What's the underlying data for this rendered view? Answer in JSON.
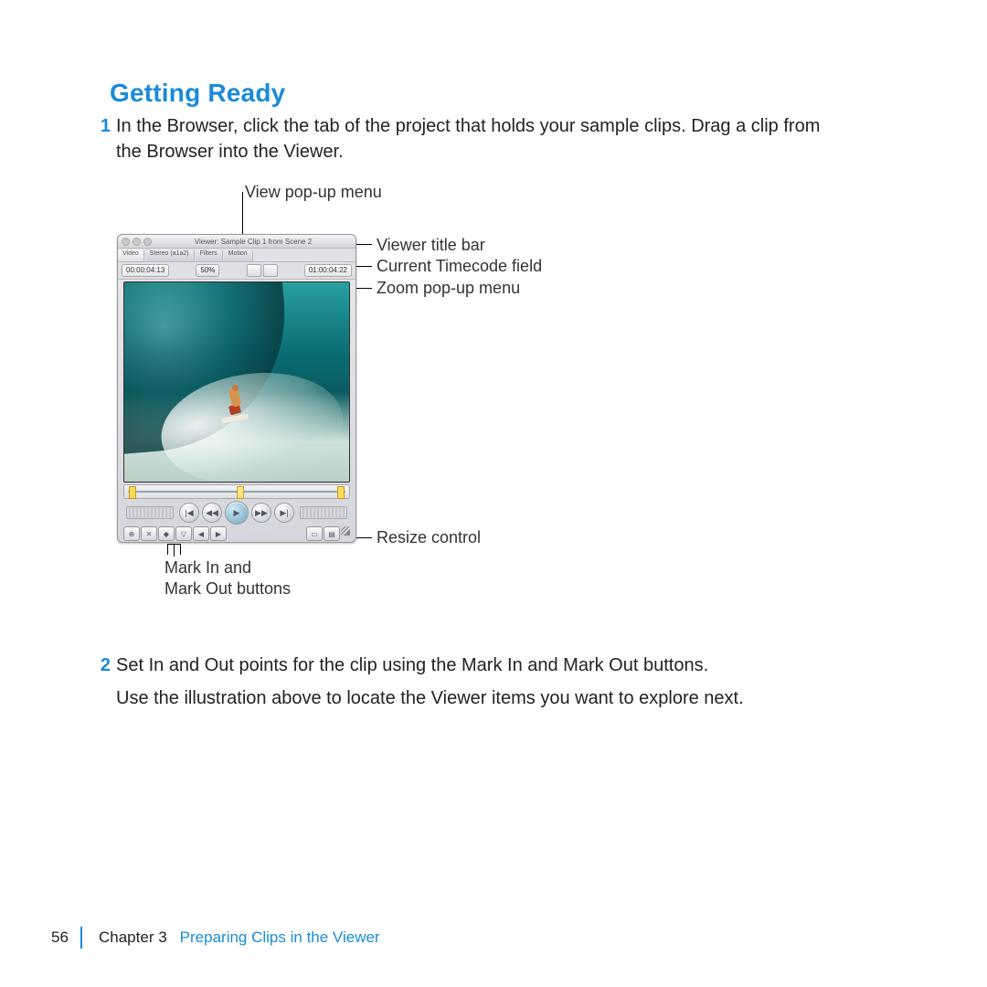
{
  "heading": "Getting Ready",
  "steps": {
    "s1": {
      "num": "1",
      "line1": "In the Browser, click the tab of the project that holds your sample clips. Drag a clip from",
      "line2": "the Browser into the Viewer."
    },
    "s2": {
      "num": "2",
      "text": "Set In and Out points for the clip using the Mark In and Mark Out buttons."
    }
  },
  "followup": "Use the illustration above to locate the Viewer items you want to explore next.",
  "callouts": {
    "view_popup": "View pop-up menu",
    "title_bar": "Viewer title bar",
    "current_tc": "Current Timecode field",
    "zoom_popup": "Zoom pop-up menu",
    "resize": "Resize control",
    "mark_in_out_l1": "Mark In and",
    "mark_in_out_l2": "Mark Out buttons"
  },
  "viewer": {
    "title": "Viewer: Sample Clip 1 from Scene 2",
    "tabs": [
      "Video",
      "Stereo (a1a2)",
      "Filters",
      "Motion"
    ],
    "tc_left": "00:00:04:13",
    "zoom": "50%",
    "tc_right": "01:00:04:22"
  },
  "footer": {
    "page": "56",
    "chapter": "Chapter 3",
    "title": "Preparing Clips in the Viewer"
  }
}
